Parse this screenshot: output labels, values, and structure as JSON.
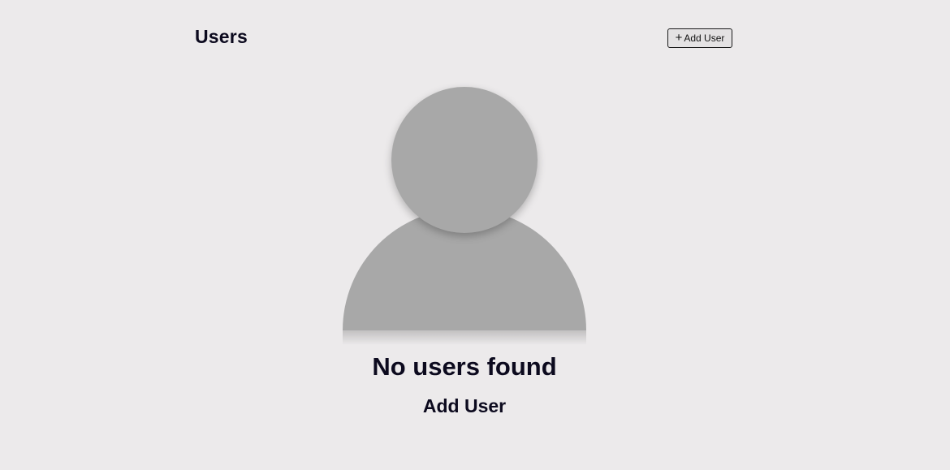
{
  "header": {
    "title": "Users",
    "add_button": {
      "icon": "plus-icon",
      "icon_glyph": "+",
      "label": "Add User"
    }
  },
  "empty_state": {
    "illustration": "user-silhouette-icon",
    "title": "No users found",
    "action_label": "Add User"
  },
  "colors": {
    "background": "#eceaeb",
    "text": "#0c0a1e",
    "silhouette": "#a8a8a8"
  }
}
